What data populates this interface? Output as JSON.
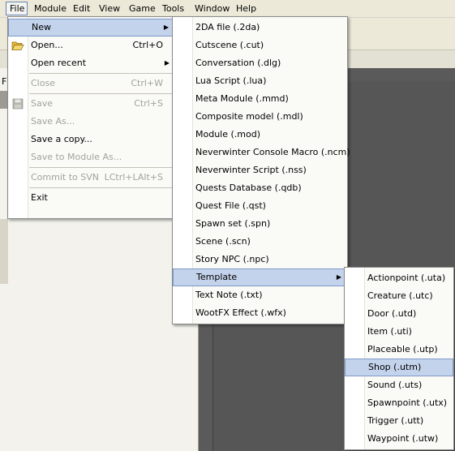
{
  "menubar": {
    "items": [
      "File",
      "Module",
      "Edit",
      "View",
      "Game",
      "Tools",
      "Window",
      "Help"
    ]
  },
  "background": {
    "left_letter": "F"
  },
  "file_menu": {
    "new": "New",
    "open": "Open...",
    "open_shortcut": "Ctrl+O",
    "open_recent": "Open recent",
    "close": "Close",
    "close_shortcut": "Ctrl+W",
    "save": "Save",
    "save_shortcut": "Ctrl+S",
    "save_as": "Save As...",
    "save_copy": "Save a copy...",
    "save_module_as": "Save to Module As...",
    "commit_svn": "Commit to SVN",
    "commit_svn_shortcut": "LCtrl+LAlt+S",
    "exit": "Exit"
  },
  "new_menu": {
    "items": [
      "2DA file (.2da)",
      "Cutscene (.cut)",
      "Conversation (.dlg)",
      "Lua Script (.lua)",
      "Meta Module (.mmd)",
      "Composite model (.mdl)",
      "Module (.mod)",
      "Neverwinter Console Macro (.ncm)",
      "Neverwinter Script (.nss)",
      "Quests Database (.qdb)",
      "Quest File (.qst)",
      "Spawn set (.spn)",
      "Scene (.scn)",
      "Story NPC (.npc)",
      "Template",
      "Text Note (.txt)",
      "WootFX Effect (.wfx)"
    ]
  },
  "template_menu": {
    "items": [
      "Actionpoint (.uta)",
      "Creature (.utc)",
      "Door (.utd)",
      "Item (.uti)",
      "Placeable (.utp)",
      "Shop (.utm)",
      "Sound (.uts)",
      "Spawnpoint (.utx)",
      "Trigger (.utt)",
      "Waypoint (.utw)"
    ]
  },
  "colors": {
    "highlight": "#c4d3ec",
    "highlight_border": "#7d99c9",
    "dark_workspace": "#5a5a5a",
    "toolbar": "#ece9d8"
  },
  "icons": {
    "open": "folder-open-icon",
    "save": "floppy-disk-icon",
    "submenu": "chevron-right-icon"
  }
}
